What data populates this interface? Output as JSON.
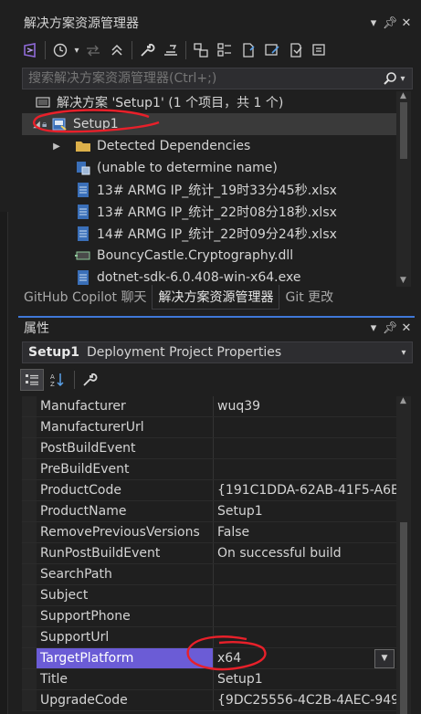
{
  "solution_explorer": {
    "title": "解决方案资源管理器",
    "search_placeholder": "搜索解决方案资源管理器(Ctrl+;)",
    "tree": [
      {
        "label": "解决方案 'Setup1' (1 个项目，共 1 个)",
        "icon": "solution-icon"
      },
      {
        "label": "Setup1",
        "icon": "setup-project-icon"
      },
      {
        "label": "Detected Dependencies",
        "icon": "folder-icon"
      },
      {
        "label": "(unable to determine name)",
        "icon": "assembly-icon"
      },
      {
        "label": "13# ARMG IP_统计_19时33分45秒.xlsx",
        "icon": "file-icon"
      },
      {
        "label": "13# ARMG IP_统计_22时08分18秒.xlsx",
        "icon": "file-icon"
      },
      {
        "label": "14# ARMG IP_统计_22时09分24秒.xlsx",
        "icon": "file-icon"
      },
      {
        "label": "BouncyCastle.Cryptography.dll",
        "icon": "dll-icon"
      },
      {
        "label": "dotnet-sdk-6.0.408-win-x64.exe",
        "icon": "file-icon"
      }
    ],
    "tabs": [
      "GitHub Copilot 聊天",
      "解决方案资源管理器",
      "Git 更改"
    ]
  },
  "properties": {
    "title": "属性",
    "object_name": "Setup1",
    "object_type": "Deployment Project Properties",
    "rows": [
      {
        "name": "Manufacturer",
        "value": "wuq39"
      },
      {
        "name": "ManufacturerUrl",
        "value": ""
      },
      {
        "name": "PostBuildEvent",
        "value": ""
      },
      {
        "name": "PreBuildEvent",
        "value": ""
      },
      {
        "name": "ProductCode",
        "value": "{191C1DDA-62AB-41F5-A6B"
      },
      {
        "name": "ProductName",
        "value": "Setup1"
      },
      {
        "name": "RemovePreviousVersions",
        "value": "False"
      },
      {
        "name": "RunPostBuildEvent",
        "value": "On successful build"
      },
      {
        "name": "SearchPath",
        "value": ""
      },
      {
        "name": "Subject",
        "value": ""
      },
      {
        "name": "SupportPhone",
        "value": ""
      },
      {
        "name": "SupportUrl",
        "value": ""
      },
      {
        "name": "TargetPlatform",
        "value": "x64"
      },
      {
        "name": "Title",
        "value": "Setup1"
      },
      {
        "name": "UpgradeCode",
        "value": "{9DC25556-4C2B-4AEC-949"
      }
    ]
  },
  "colors": {
    "background": "#1f1f1f",
    "selection": "#6b5cd6",
    "annotation": "#e8202a",
    "accent": "#3f78d8"
  }
}
